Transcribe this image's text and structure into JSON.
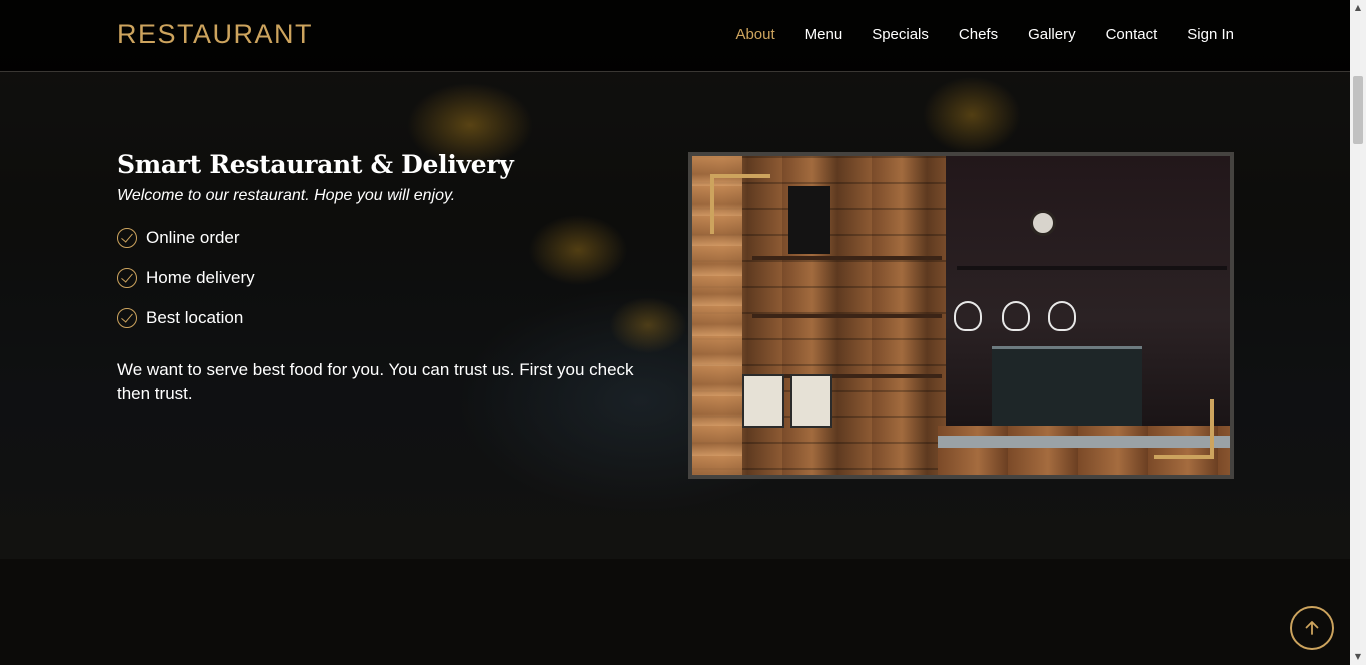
{
  "header": {
    "logo": "RESTAURANT",
    "nav": [
      {
        "label": "About",
        "active": true
      },
      {
        "label": "Menu",
        "active": false
      },
      {
        "label": "Specials",
        "active": false
      },
      {
        "label": "Chefs",
        "active": false
      },
      {
        "label": "Gallery",
        "active": false
      },
      {
        "label": "Contact",
        "active": false
      },
      {
        "label": "Sign In",
        "active": false
      }
    ]
  },
  "about": {
    "title": "Smart Restaurant & Delivery",
    "subtitle": "Welcome to our restaurant. Hope you will enjoy.",
    "features": [
      "Online order",
      "Home delivery",
      "Best location"
    ],
    "description": "We want to serve best food for you. You can trust us. First you check then trust."
  },
  "icons": {
    "feature_check": "check-circle-icon",
    "back_to_top": "arrow-up-icon"
  },
  "colors": {
    "accent": "#cda45e",
    "background": "#0c0b09",
    "text": "#ffffff"
  }
}
